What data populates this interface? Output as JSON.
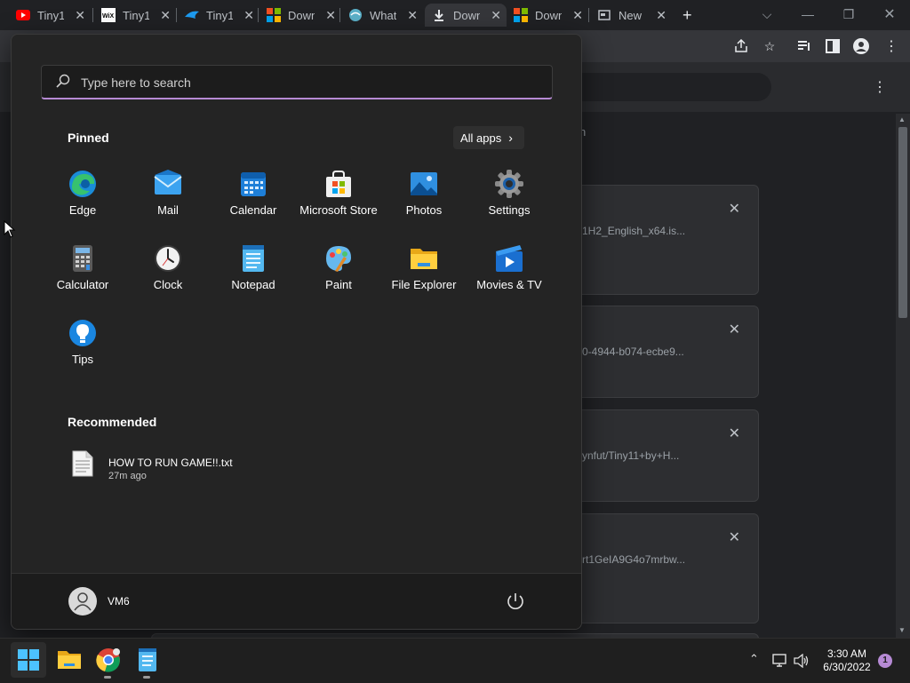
{
  "browser": {
    "tabs": [
      {
        "title": "Tiny1",
        "icon": "youtube-icon"
      },
      {
        "title": "Tiny1",
        "icon": "wix-icon"
      },
      {
        "title": "Tiny1",
        "icon": "bird-icon"
      },
      {
        "title": "Down",
        "icon": "microsoft-icon"
      },
      {
        "title": "What",
        "icon": "globe-icon"
      },
      {
        "title": "Down",
        "icon": "download-icon"
      },
      {
        "title": "Down",
        "icon": "microsoft-icon"
      },
      {
        "title": "New",
        "icon": "newtab-icon"
      }
    ],
    "new_tab_glyph": "+",
    "downloads": {
      "partial_header": "n",
      "items": [
        {
          "text": "1H2_English_x64.is..."
        },
        {
          "text": "0-4944-b074-ecbe9..."
        },
        {
          "text": "ynfut/Tiny11+by+H..."
        },
        {
          "text": "rt1GeIA9G4o7mrbw..."
        }
      ]
    }
  },
  "start_menu": {
    "search_placeholder": "Type here to search",
    "pinned_title": "Pinned",
    "all_apps_label": "All apps",
    "pinned": [
      {
        "label": "Edge",
        "icon": "edge-icon"
      },
      {
        "label": "Mail",
        "icon": "mail-icon"
      },
      {
        "label": "Calendar",
        "icon": "calendar-icon"
      },
      {
        "label": "Microsoft Store",
        "icon": "store-icon"
      },
      {
        "label": "Photos",
        "icon": "photos-icon"
      },
      {
        "label": "Settings",
        "icon": "settings-icon"
      },
      {
        "label": "Calculator",
        "icon": "calculator-icon"
      },
      {
        "label": "Clock",
        "icon": "clock-icon"
      },
      {
        "label": "Notepad",
        "icon": "notepad-icon"
      },
      {
        "label": "Paint",
        "icon": "paint-icon"
      },
      {
        "label": "File Explorer",
        "icon": "folder-icon"
      },
      {
        "label": "Movies & TV",
        "icon": "movies-icon"
      },
      {
        "label": "Tips",
        "icon": "tips-icon"
      }
    ],
    "recommended_title": "Recommended",
    "recommended": [
      {
        "name": "HOW TO RUN GAME!!.txt",
        "time": "27m ago",
        "icon": "text-file-icon"
      }
    ],
    "user_name": "VM6"
  },
  "taskbar": {
    "time": "3:30 AM",
    "date": "6/30/2022",
    "notification_count": "1"
  },
  "colors": {
    "accent": "#b68ad4",
    "start_bg": "#242424",
    "taskbar_bg": "#1f1f1f"
  }
}
